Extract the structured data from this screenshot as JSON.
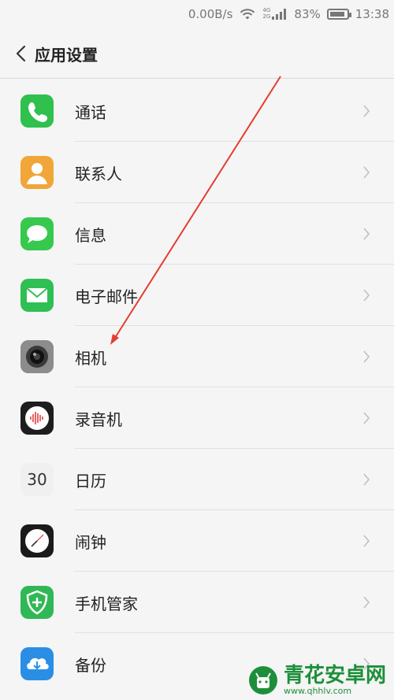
{
  "status": {
    "speed": "0.00B/s",
    "net_top": "4G",
    "net_bottom": "2G",
    "battery": "83%",
    "time": "13:38"
  },
  "header": {
    "title": "应用设置"
  },
  "items": [
    {
      "label": "通话",
      "icon": "phone-icon",
      "color": "#2fc04e"
    },
    {
      "label": "联系人",
      "icon": "contacts-icon",
      "color": "#f0a638"
    },
    {
      "label": "信息",
      "icon": "messages-icon",
      "color": "#36c94d"
    },
    {
      "label": "电子邮件",
      "icon": "mail-icon",
      "color": "#2fbf55"
    },
    {
      "label": "相机",
      "icon": "camera-icon",
      "color": "#7d7d7d"
    },
    {
      "label": "录音机",
      "icon": "recorder-icon",
      "color": "#1d1d1d"
    },
    {
      "label": "日历",
      "icon": "calendar-icon",
      "color": "#f0f0f0",
      "text": "30"
    },
    {
      "label": "闹钟",
      "icon": "clock-icon",
      "color": "#1a1a1a"
    },
    {
      "label": "手机管家",
      "icon": "phone-manager-icon",
      "color": "#31b856"
    },
    {
      "label": "备份",
      "icon": "backup-icon",
      "color": "#2b8ee5"
    }
  ],
  "watermark": {
    "brand": "青花安卓网",
    "url": "www.qhhlv.com"
  }
}
